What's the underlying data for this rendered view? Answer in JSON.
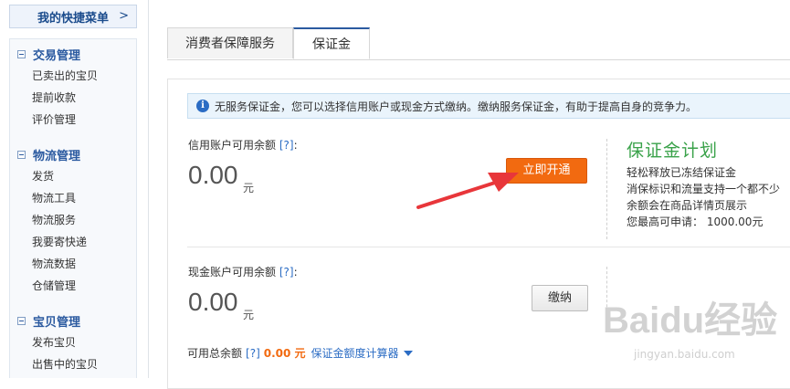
{
  "sidebar": {
    "quick_menu_label": "我的快捷菜单",
    "quick_menu_chevron": ">",
    "groups": [
      {
        "title": "交易管理",
        "items": [
          "已卖出的宝贝",
          "提前收款",
          "评价管理"
        ]
      },
      {
        "title": "物流管理",
        "items": [
          "发货",
          "物流工具",
          "物流服务",
          "我要寄快递",
          "物流数据",
          "仓储管理"
        ]
      },
      {
        "title": "宝贝管理",
        "items": [
          "发布宝贝",
          "出售中的宝贝"
        ]
      }
    ]
  },
  "tabs": [
    {
      "label": "消费者保障服务",
      "active": false
    },
    {
      "label": "保证金",
      "active": true
    }
  ],
  "notice": {
    "icon": "info-icon",
    "text": "无服务保证金，您可以选择信用账户或现金方式缴纳。缴纳服务保证金，有助于提高自身的竞争力。"
  },
  "credit": {
    "label": "信用账户可用余额",
    "help": "[?]",
    "colon": ":",
    "amount": "0.00",
    "unit": "元",
    "button": "立即开通"
  },
  "plan": {
    "logo": "保证金计划",
    "lines": [
      "轻松释放已冻结保证金",
      "消保标识和流量支持一个都不少",
      "余额会在商品详情页展示",
      "您最高可申请： 1000.00元"
    ]
  },
  "cash": {
    "label": "现金账户可用余额",
    "help": "[?]",
    "colon": ":",
    "amount": "0.00",
    "unit": "元",
    "button": "缴纳"
  },
  "footer": {
    "label": "可用总余额",
    "help": "[?]",
    "amount": "0.00 元",
    "calculator": "保证金额度计算器"
  },
  "watermark": {
    "text": "Baidu经验",
    "sub": "jingyan.baidu.com"
  },
  "colors": {
    "accent": "#2b5aa0",
    "button_orange": "#f26a10",
    "plan_green": "#3aa24a",
    "arrow_red": "#e8363a"
  }
}
